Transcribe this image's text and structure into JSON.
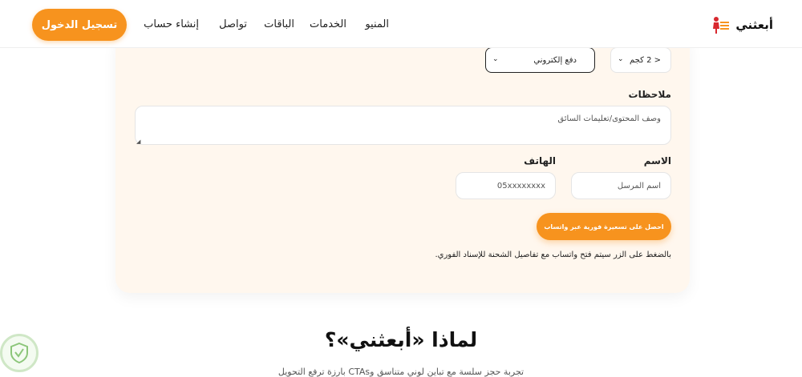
{
  "nav": {
    "brand": "أبعثني",
    "links": [
      "المنيو",
      "الخدمات",
      "الباقات",
      "تواصل",
      "إنشاء حساب"
    ],
    "login": "تسجيل الدخول"
  },
  "form": {
    "weight_select": "< 2 كجم",
    "payment_select": "دفع إلكتروني",
    "notes_label": "ملاحظات",
    "notes_placeholder": "وصف المحتوى/تعليمات السائق",
    "name_label": "الاسم",
    "name_placeholder": "اسم المرسل",
    "phone_label": "الهاتف",
    "phone_placeholder": "05xxxxxxxx",
    "submit": "احصل على تسعيرة فورية عبر واتساب",
    "note": "بالضغط على الزر سيتم فتح واتساب مع تفاصيل الشحنة للإسناد الفوري."
  },
  "section": {
    "title": "لماذا «أبعثني»؟",
    "subtitle": "تجربة حجز سلسة مع تباين لوني متناسق وCTAs بارزة ترفع التحويل"
  },
  "colors": {
    "accent": "#f7931e",
    "card": "#fff7ee"
  },
  "icons": [
    "logo-icon",
    "chevron-down-icon",
    "resize-handle-icon",
    "verified-badge-icon"
  ]
}
